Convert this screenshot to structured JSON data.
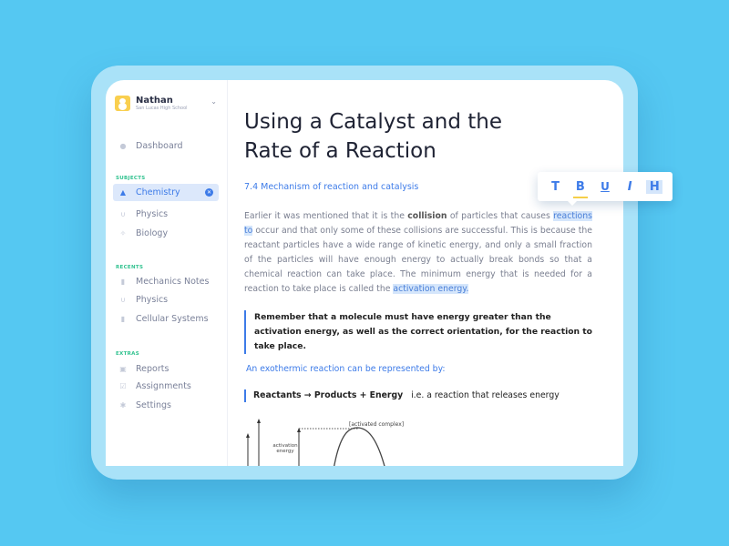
{
  "user": {
    "name": "Nathan",
    "school": "San Lucas High School"
  },
  "sidebar": {
    "dashboard": "Dashboard",
    "subjects_label": "SUBJECTS",
    "subjects": [
      {
        "label": "Chemistry",
        "icon": "flask-icon",
        "active": true
      },
      {
        "label": "Physics",
        "icon": "magnet-icon"
      },
      {
        "label": "Biology",
        "icon": "molecule-icon"
      }
    ],
    "recents_label": "RECENTS",
    "recents": [
      {
        "label": "Mechanics Notes",
        "icon": "document-icon"
      },
      {
        "label": "Physics",
        "icon": "magnet-icon"
      },
      {
        "label": "Cellular Systems",
        "icon": "document-icon"
      }
    ],
    "extras_label": "EXTRAS",
    "extras": [
      {
        "label": "Reports",
        "icon": "chart-icon"
      },
      {
        "label": "Assignments",
        "icon": "check-icon"
      },
      {
        "label": "Settings",
        "icon": "settings-icon"
      }
    ]
  },
  "main": {
    "title": "Using a Catalyst and the Rate of a Reaction",
    "section": "7.4  Mechanism of reaction and catalysis",
    "p_1": "Earlier it was mentioned that it is the ",
    "p_bold": "collision",
    "p_2": " of particles that causes ",
    "p_hl1": "reactions to",
    "p_3": " occur and that only some of these collisions are successful. This is because the reactant particles have a wide range of kinetic energy, and only a small fraction of the particles will have enough energy to actually break bonds so that a chemical reaction can take place. The minimum energy that is needed for a reaction to take place is called the ",
    "p_hl2": "activation energy.",
    "quote": "Remember that a molecule must have energy greater than the activation energy, as well as the correct orientation, for the reaction to take place.",
    "exo": "An exothermic reaction can be represented by:",
    "eq_bold": "Reactants → Products + Energy",
    "eq_rest": "   i.e. a reaction that releases energy",
    "diagram": {
      "complex": "[activated complex]",
      "activation_1": "activation",
      "activation_2": "energy"
    }
  },
  "toolbar": {
    "t": "T",
    "b": "B",
    "u": "U",
    "i": "I",
    "h": "H"
  },
  "colors": {
    "accent": "#3d7be8",
    "section": "#31c28f",
    "background": "#55c8f2",
    "highlight": "#d5e6fb",
    "underline": "#f5cf4a"
  }
}
